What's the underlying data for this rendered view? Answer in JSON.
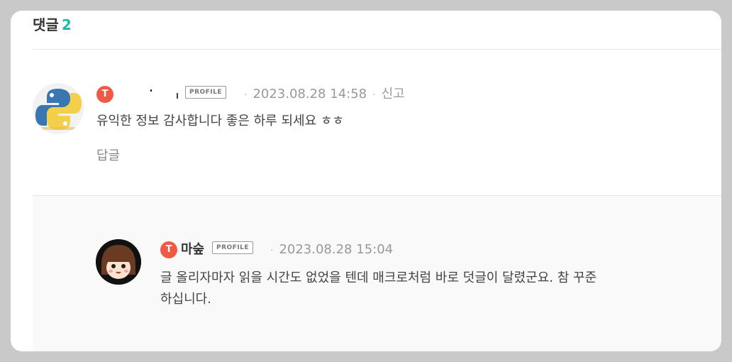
{
  "comments_section": {
    "label": "댓글",
    "count": "2"
  },
  "comments": [
    {
      "author": "",
      "profile_label": "PROFILE",
      "date": "2023.08.28 14:58",
      "report_label": "신고",
      "text": "유익한 정보 감사합니다 좋은 하루 되세요 ㅎㅎ",
      "reply_label": "답글",
      "avatar": "python-logo-avatar"
    }
  ],
  "replies": [
    {
      "author": "마숲",
      "profile_label": "PROFILE",
      "date": "2023.08.28 15:04",
      "text_line1": "글 올리자마자 읽을 시간도 없었을 텐데 매크로처럼 바로 덧글이 달렸군요. 참 꾸준",
      "text_line2": "하십니다.",
      "avatar": "cartoon-girl-avatar"
    }
  ],
  "colors": {
    "accent": "#1bbbab",
    "badge": "#ef5a45"
  }
}
